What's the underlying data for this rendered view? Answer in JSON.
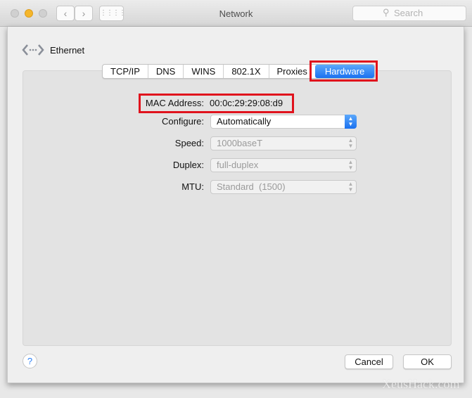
{
  "window": {
    "title": "Network",
    "search_placeholder": "Search"
  },
  "header": {
    "interface_name": "Ethernet"
  },
  "tabs": [
    {
      "label": "TCP/IP"
    },
    {
      "label": "DNS"
    },
    {
      "label": "WINS"
    },
    {
      "label": "802.1X"
    },
    {
      "label": "Proxies"
    },
    {
      "label": "Hardware",
      "active": true
    }
  ],
  "hardware": {
    "mac_label": "MAC Address:",
    "mac_value": "00:0c:29:29:08:d9",
    "configure_label": "Configure:",
    "configure_value": "Automatically",
    "speed_label": "Speed:",
    "speed_value": "1000baseT",
    "duplex_label": "Duplex:",
    "duplex_value": "full-duplex",
    "mtu_label": "MTU:",
    "mtu_value": "Standard  (1500)"
  },
  "footer": {
    "help": "?",
    "cancel": "Cancel",
    "ok": "OK"
  },
  "watermark": "XeusHack.com",
  "colors": {
    "accent": "#1a71f0",
    "highlight_box": "#e0131d"
  }
}
